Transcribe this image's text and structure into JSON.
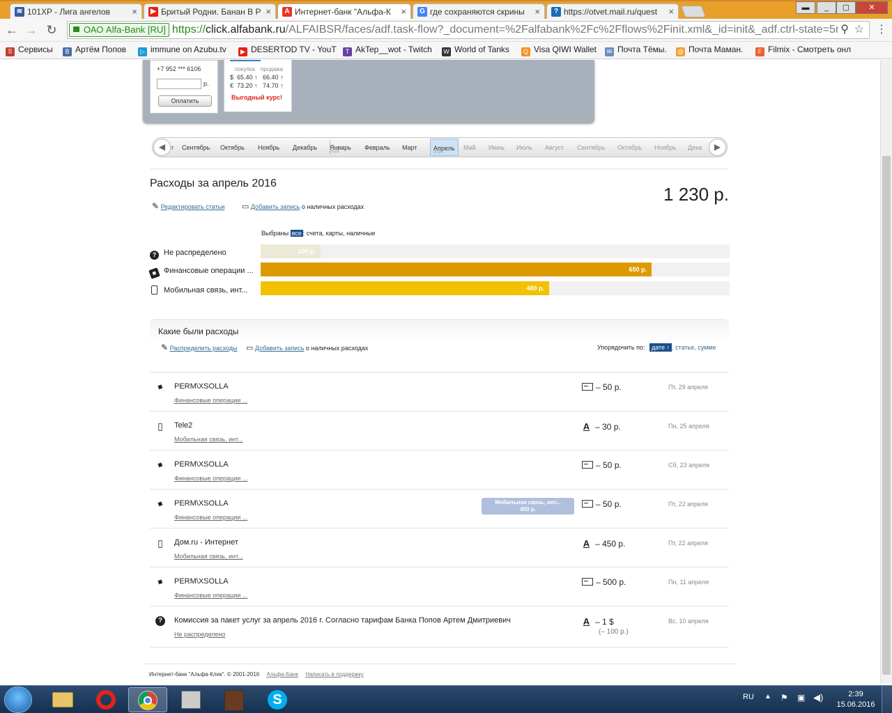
{
  "browser": {
    "tabs": [
      {
        "title": "101XP - Лига ангелов",
        "icon": "101xp-icon",
        "color": "#3a5c9a",
        "letter": "≋"
      },
      {
        "title": "Бритый Родни. Банан В Р",
        "icon": "youtube-icon",
        "color": "#e62117",
        "letter": "▶"
      },
      {
        "title": "Интернет-банк \"Альфа-К",
        "icon": "alfa-icon",
        "color": "#ef3124",
        "letter": "A"
      },
      {
        "title": "где сохраняются скрины",
        "icon": "google-icon",
        "color": "#4285f4",
        "letter": "G"
      },
      {
        "title": "https://otvet.mail.ru/quest",
        "icon": "help-icon",
        "color": "#1b6cb5",
        "letter": "?"
      }
    ],
    "ev_label": "ОАО Alfa-Bank [RU]",
    "url_scheme": "https://",
    "url_host": "click.alfabank.ru",
    "url_path": "/ALFAIBSR/faces/adf.task-flow?_document=%2Falfabank%2Fc%2Fflows%2Finit.xml&_id=init&_adf.ctrl-state=5n4",
    "bookmarks": [
      {
        "label": "Сервисы",
        "color": "#c04030",
        "letter": "⠿"
      },
      {
        "label": "Артём Попов",
        "color": "#4a6ea8",
        "letter": "B"
      },
      {
        "label": "immune on Azubu.tv",
        "color": "#1b9ad6",
        "letter": "▷"
      },
      {
        "label": "DESERTOD TV - YouT",
        "color": "#e62117",
        "letter": "▶"
      },
      {
        "label": "AkTep__wot - Twitch",
        "color": "#6441a5",
        "letter": "T"
      },
      {
        "label": "World of Tanks",
        "color": "#333333",
        "letter": "W"
      },
      {
        "label": "Visa QIWI Wallet",
        "color": "#f29423",
        "letter": "Q"
      },
      {
        "label": "Почта Тёмы.",
        "color": "#6a8ec0",
        "letter": "✉"
      },
      {
        "label": "Почта Маман.",
        "color": "#f0a030",
        "letter": "@"
      },
      {
        "label": "Filmix - Смотреть онл",
        "color": "#f06030",
        "letter": "F"
      }
    ]
  },
  "banner": {
    "phone": "+7 952 *** 6106",
    "currency_unit": "р.",
    "pay_button": "Оплатить",
    "rates_header_buy": "покупка",
    "rates_header_sell": "продажа",
    "rate_usd": "$  65.40 ↑   66.40 ↑",
    "rate_eur": "€  73.20 ↑   74.70 ↑",
    "promo": "Выгодный курс!"
  },
  "months": [
    {
      "label": "г",
      "year": ""
    },
    {
      "label": "Сентябрь",
      "year": ""
    },
    {
      "label": "Октябрь",
      "year": ""
    },
    {
      "label": "Ноябрь",
      "year": ""
    },
    {
      "label": "Декабрь",
      "year": ""
    },
    {
      "label": "Январь",
      "year": "2016"
    },
    {
      "label": "Февраль",
      "year": ""
    },
    {
      "label": "Март",
      "year": ""
    },
    {
      "label": "Апрель",
      "year": "2016"
    },
    {
      "label": "Май",
      "year": ""
    },
    {
      "label": "Июнь",
      "year": ""
    },
    {
      "label": "Июль",
      "year": ""
    },
    {
      "label": "Август",
      "year": ""
    },
    {
      "label": "Сентябрь",
      "year": ""
    },
    {
      "label": "Октябрь",
      "year": ""
    },
    {
      "label": "Ноябрь",
      "year": ""
    },
    {
      "label": "Дека",
      "year": ""
    }
  ],
  "summary": {
    "title": "Расходы за апрель 2016",
    "total": "1 230 р.",
    "edit_link": "Редактировать статьи",
    "add_link": "Добавить запись",
    "add_suffix": "о наличных расходах",
    "selected_prefix": "Выбраны",
    "selected_badge": "все",
    "selected_suffix": ": счета, карты, наличные"
  },
  "chart_data": {
    "type": "bar",
    "categories": [
      "Не распределено",
      "Финансовые операции ...",
      "Мобильная связь, инт..."
    ],
    "values": [
      100,
      650,
      480
    ],
    "value_labels": [
      "100 р.",
      "650 р.",
      "480 р."
    ],
    "xlim": [
      0,
      780
    ],
    "colors": [
      "#ece9d8",
      "#dd9a00",
      "#f2c100"
    ]
  },
  "expenses": {
    "title": "Какие были расходы",
    "distribute_link": "Распределить расходы",
    "add_link": "Добавить запись",
    "add_suffix": "о наличных расходах",
    "sort_label": "Упорядочить по:",
    "sort_active": "дате ↑",
    "sort_options": ", статье, сумме",
    "rows": [
      {
        "name": "PERM\\XSOLLA",
        "category": "Финансовые операции ...",
        "amount": "– 50 р.",
        "date": "Пт, 29 апреля",
        "kind": "finance",
        "method": "card"
      },
      {
        "name": "Tele2",
        "category": "Мобильная связь, инт...",
        "amount": "– 30 р.",
        "date": "Пн, 25 апреля",
        "kind": "mobile",
        "method": "alfa"
      },
      {
        "name": "PERM\\XSOLLA",
        "category": "Финансовые операции ...",
        "amount": "– 50 р.",
        "date": "Сб, 23 апреля",
        "kind": "finance",
        "method": "card"
      },
      {
        "name": "PERM\\XSOLLA",
        "category": "Финансовые операции ...",
        "amount": "– 50 р.",
        "date": "Пт, 22 апреля",
        "kind": "finance",
        "method": "card"
      },
      {
        "name": "Дом.ru - Интернет",
        "category": "Мобильная связь, инт...",
        "amount": "– 450 р.",
        "date": "Пт, 22 апреля",
        "kind": "mobile",
        "method": "alfa"
      },
      {
        "name": "PERM\\XSOLLA",
        "category": "Финансовые операции ...",
        "amount": "– 500 р.",
        "date": "Пн, 11 апреля",
        "kind": "finance",
        "method": "card"
      },
      {
        "name": "Комиссия за пакет услуг за апрель 2016 г. Согласно тарифам Банка Попов Артем Дмитриевич",
        "category": "Не распределено",
        "amount": "– 1 $",
        "amount_sub": "(– 100 р.)",
        "date": "Вс, 10 апреля",
        "kind": "unknown",
        "method": "alfa"
      }
    ],
    "drag_tooltip_line1": "Мобильная связь, инт...",
    "drag_tooltip_line2": "450 р."
  },
  "footer": {
    "copyright": "Интернет-банк \"Альфа-Клик\". © 2001-2016",
    "link1": "Альфа-Банк",
    "link2": "Написать в поддержку"
  },
  "taskbar": {
    "lang": "RU",
    "time": "2:39",
    "date": "15.06.2016"
  }
}
